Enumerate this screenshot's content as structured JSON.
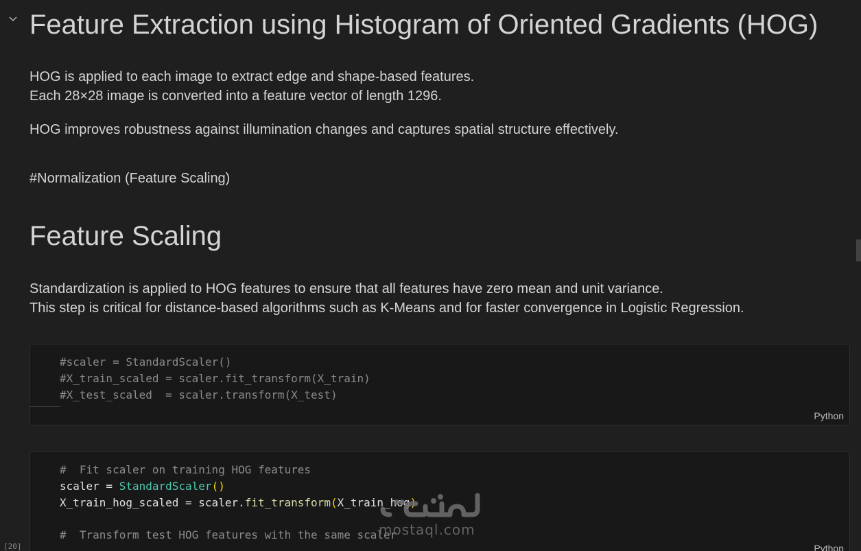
{
  "markdown": {
    "title": "Feature Extraction using Histogram of Oriented Gradients (HOG)",
    "para1_line1": "HOG is applied to each image to extract edge and shape-based features.",
    "para1_line2": "Each 28×28 image is converted into a feature vector of length 1296.",
    "para2": "HOG improves robustness against illumination changes and captures spatial structure effectively.",
    "para3": "#Normalization (Feature Scaling)",
    "heading2": "Feature Scaling",
    "para4_line1": "Standardization is applied to HOG features to ensure that all features have zero mean and unit variance.",
    "para4_line2": "This step is critical for distance-based algorithms such as K-Means and for faster convergence in Logistic Regression."
  },
  "cell1": {
    "lines": [
      "#scaler = StandardScaler()",
      "#X_train_scaled = scaler.fit_transform(X_train)",
      "#X_test_scaled  = scaler.transform(X_test)"
    ],
    "language": "Python"
  },
  "cell2": {
    "comment1": "#  Fit scaler on training HOG features",
    "line2_var": "scaler = ",
    "line2_cls": "StandardScaler",
    "line2_paren": "()",
    "line3_a": "X_train_hog_scaled = scaler.",
    "line3_fn": "fit_transform",
    "line3_open": "(",
    "line3_arg": "X_train_hog",
    "line3_close": ")",
    "comment2": "#  Transform test HOG features with the same scaler",
    "language": "Python",
    "exec_count": "[20]"
  },
  "watermark": {
    "text": "mostaql.com",
    "arabic": "مستقل"
  },
  "icons": {
    "collapse": "chevron-down-icon"
  }
}
